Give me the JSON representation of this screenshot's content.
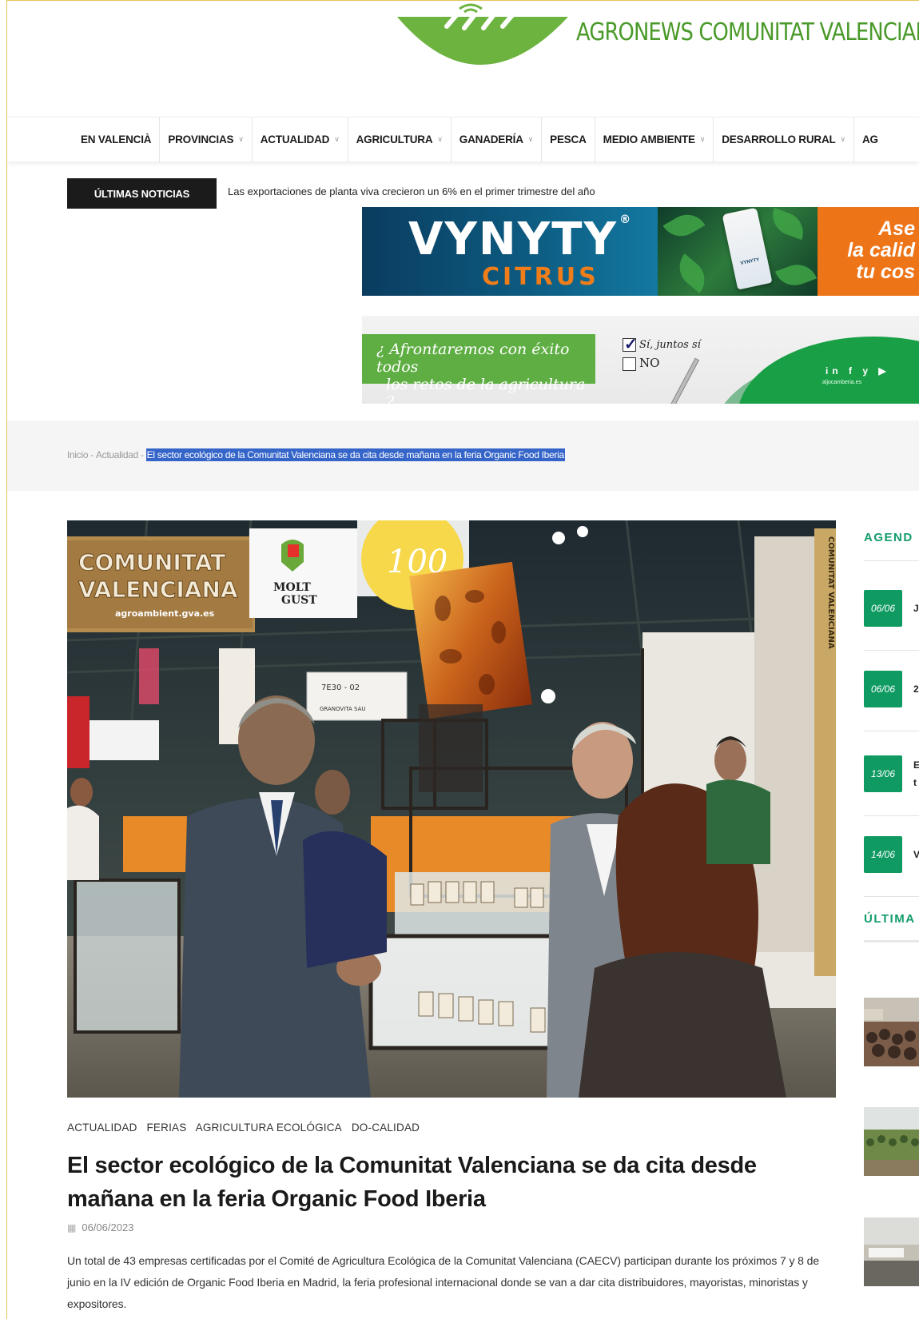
{
  "header": {
    "site_name": "AGRONEWS COMUNITAT VALENCIANA"
  },
  "nav": {
    "items": [
      {
        "label": "EN VALENCIÀ",
        "has_dropdown": false
      },
      {
        "label": "PROVINCIAS",
        "has_dropdown": true
      },
      {
        "label": "ACTUALIDAD",
        "has_dropdown": true
      },
      {
        "label": "AGRICULTURA",
        "has_dropdown": true
      },
      {
        "label": "GANADERÍA",
        "has_dropdown": true
      },
      {
        "label": "PESCA",
        "has_dropdown": false
      },
      {
        "label": "MEDIO AMBIENTE",
        "has_dropdown": true
      },
      {
        "label": "DESARROLLO RURAL",
        "has_dropdown": true
      },
      {
        "label": "AG",
        "has_dropdown": false
      }
    ]
  },
  "ticker": {
    "label": "ÚLTIMAS NOTICIAS",
    "headline": "Las exportaciones de planta viva crecieron un 6% en el primer trimestre del año"
  },
  "ads": {
    "vynyty": {
      "brand": "VYNYTY",
      "brand_mark": "®",
      "sub": "CITRUS",
      "bottle_label": "VYNYTY",
      "slogan": [
        "Ase",
        "la calid",
        "tu cos"
      ]
    },
    "retos": {
      "question_line1": "¿ Afrontaremos con éxito todos",
      "question_line2": "los retos de la agricultura ?",
      "option_yes": "Sí, juntos sí",
      "option_no": "NO",
      "social": "in f y ▶",
      "site": "aljocamberia.es"
    }
  },
  "breadcrumb": {
    "home": "Inicio",
    "section": "Actualidad",
    "current": "El sector ecológico de la Comunitat Valenciana se da cita desde mañana en la feria Organic Food Iberia"
  },
  "hero": {
    "booth_line1": "COMUNITAT",
    "booth_line2": "VALENCIANA",
    "booth_url": "agroambient.gva.es",
    "molt_line1": "MOLT",
    "molt_line2": "GUST",
    "circle_text": "100",
    "stand_number": "7E30 - 02",
    "stand_company": "GRANOVITA SAU",
    "pillar_text": "COMUNITAT VALENCIANA"
  },
  "sidebar": {
    "agenda_title": "AGEND",
    "events": [
      {
        "date": "06/06",
        "text": "J"
      },
      {
        "date": "06/06",
        "text": "2"
      },
      {
        "date": "13/06",
        "text": "E\nt"
      },
      {
        "date": "14/06",
        "text": "V"
      }
    ],
    "latest_title": "ÚLTIMA"
  },
  "article": {
    "categories": [
      "ACTUALIDAD",
      "FERIAS",
      "AGRICULTURA ECOLÓGICA",
      "DO-CALIDAD"
    ],
    "title": "El sector ecológico de la Comunitat Valenciana se da cita desde mañana en la feria Organic Food Iberia",
    "date": "06/06/2023",
    "lead": "Un total de 43 empresas certificadas por el Comité de Agricultura Ecológica de la Comunitat Valenciana (CAECV) participan durante los próximos 7 y 8 de junio en la IV edición de Organic Food Iberia en Madrid, la feria profesional internacional donde se van a dar cita distribuidores, mayoristas, minoristas y expositores."
  },
  "colors": {
    "brand_green": "#4a9a2a",
    "accent_green": "#0f9a62",
    "ticker_bg": "#1b1b1b",
    "selection_blue": "#3565c8"
  }
}
